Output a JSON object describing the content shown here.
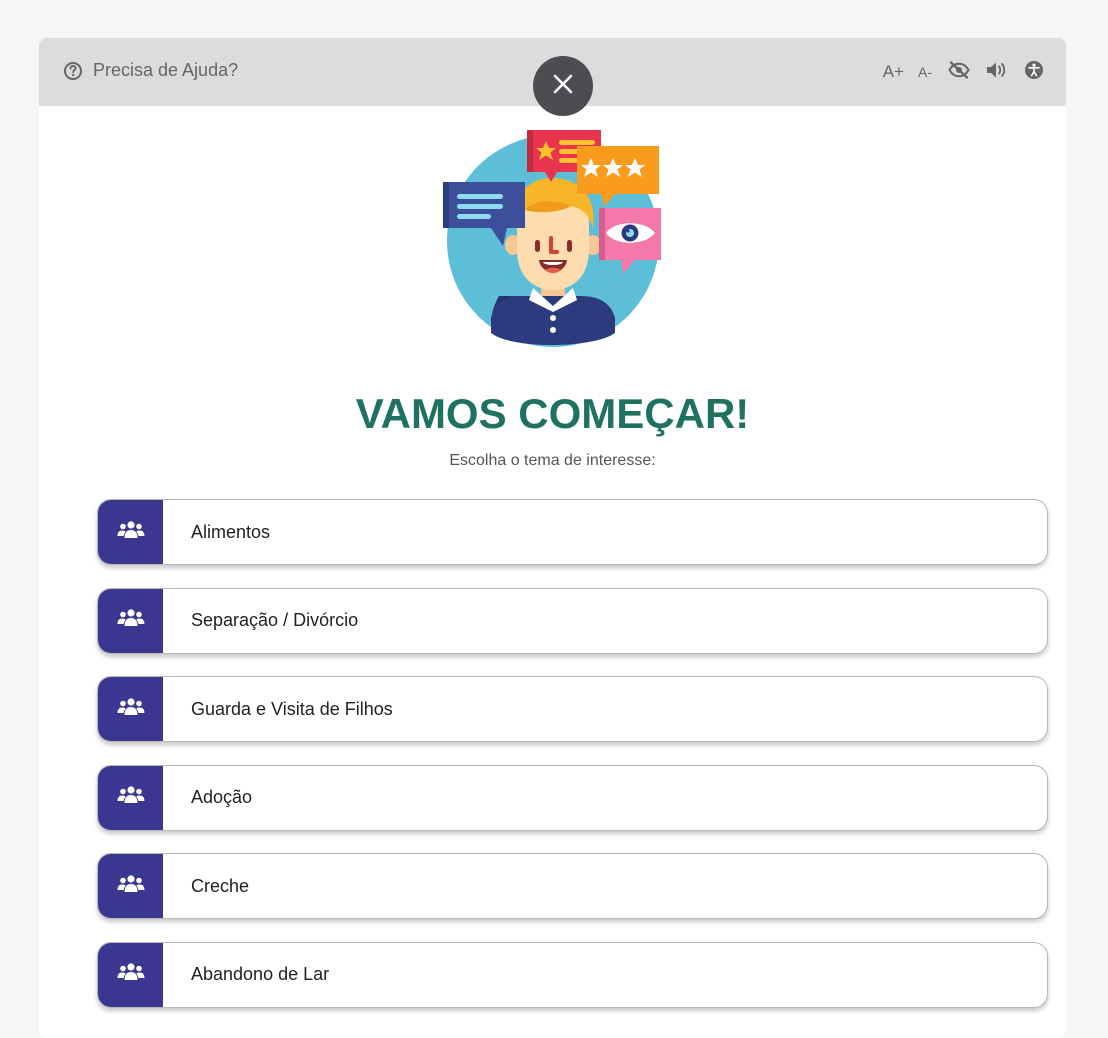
{
  "header": {
    "help_label": "Precisa de Ajuda?",
    "help_icon": "question-circle-icon",
    "tools": {
      "font_increase": "A+",
      "font_decrease": "A-",
      "contrast_icon": "eye-slash-icon",
      "audio_icon": "speaker-icon",
      "accessibility_icon": "accessibility-icon"
    },
    "close_icon": "close-icon"
  },
  "main": {
    "title": "VAMOS COMEÇAR!",
    "subtitle": "Escolha o tema de interesse:",
    "topics": [
      {
        "label": "Alimentos",
        "icon": "users-icon"
      },
      {
        "label": "Separação / Divórcio",
        "icon": "users-icon"
      },
      {
        "label": "Guarda e Visita de Filhos",
        "icon": "users-icon"
      },
      {
        "label": "Adoção",
        "icon": "users-icon"
      },
      {
        "label": "Creche",
        "icon": "users-icon"
      },
      {
        "label": "Abandono de Lar",
        "icon": "users-icon"
      }
    ]
  },
  "colors": {
    "title": "#1f7262",
    "badge": "#3a3790",
    "topbar": "#dcdcdc",
    "close_button": "#4b4d50"
  }
}
